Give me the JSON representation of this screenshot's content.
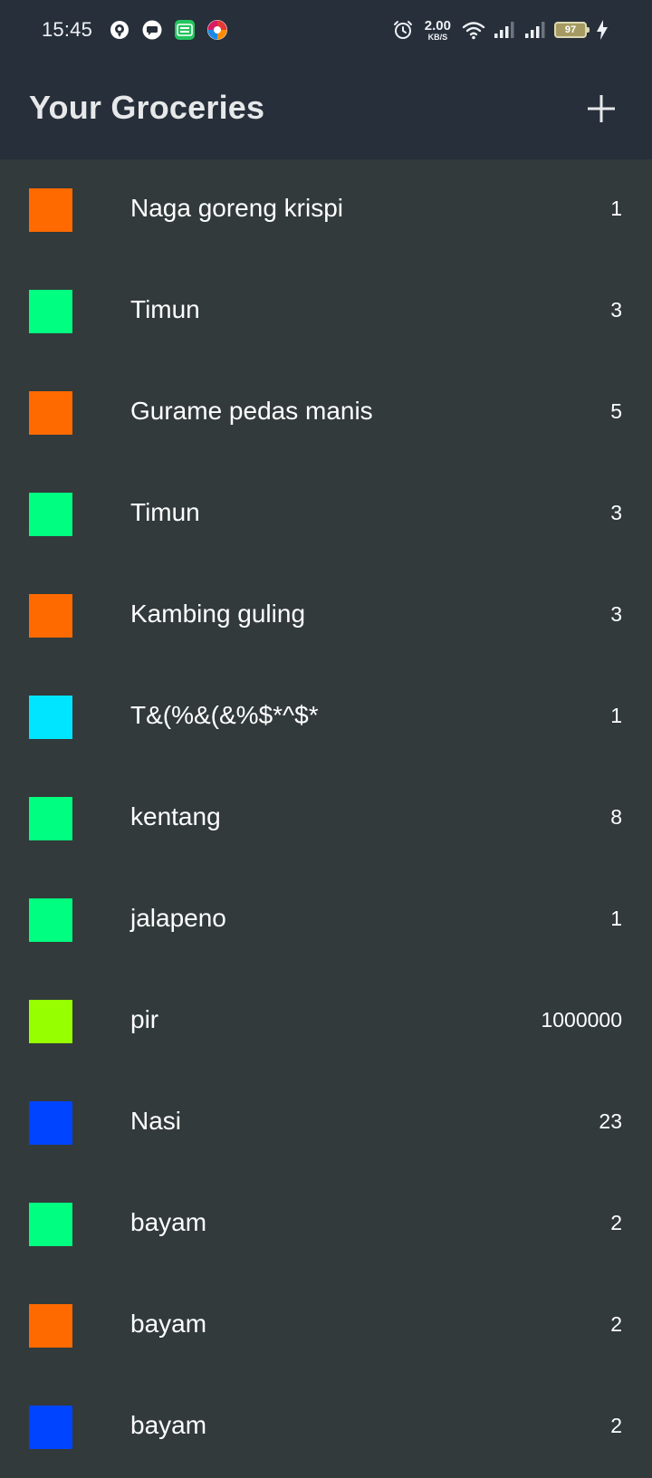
{
  "status_bar": {
    "time": "15:45",
    "left_icons": [
      "circle-app-icon",
      "chat-icon",
      "ok-google-icon",
      "pinwheel-icon"
    ],
    "speed_value": "2.00",
    "speed_unit": "KB/S",
    "battery": "97"
  },
  "app_bar": {
    "title": "Your Groceries",
    "add_icon": "plus-icon"
  },
  "groceries": [
    {
      "name": "Naga goreng krispi",
      "quantity": "1",
      "color": "#ff6a00"
    },
    {
      "name": "Timun",
      "quantity": "3",
      "color": "#00ff80"
    },
    {
      "name": "Gurame pedas manis",
      "quantity": "5",
      "color": "#ff6a00"
    },
    {
      "name": "Timun",
      "quantity": "3",
      "color": "#00ff80"
    },
    {
      "name": "Kambing guling",
      "quantity": "3",
      "color": "#ff6a00"
    },
    {
      "name": "T&(%&(&%$*^$*",
      "quantity": "1",
      "color": "#00e5ff"
    },
    {
      "name": "kentang",
      "quantity": "8",
      "color": "#00ff80"
    },
    {
      "name": "jalapeno",
      "quantity": "1",
      "color": "#00ff80"
    },
    {
      "name": "pir",
      "quantity": "1000000",
      "color": "#96ff00"
    },
    {
      "name": "Nasi",
      "quantity": "23",
      "color": "#0044ff"
    },
    {
      "name": "bayam",
      "quantity": "2",
      "color": "#00ff80"
    },
    {
      "name": "bayam",
      "quantity": "2",
      "color": "#ff6a00"
    },
    {
      "name": "bayam",
      "quantity": "2",
      "color": "#0044ff"
    }
  ]
}
